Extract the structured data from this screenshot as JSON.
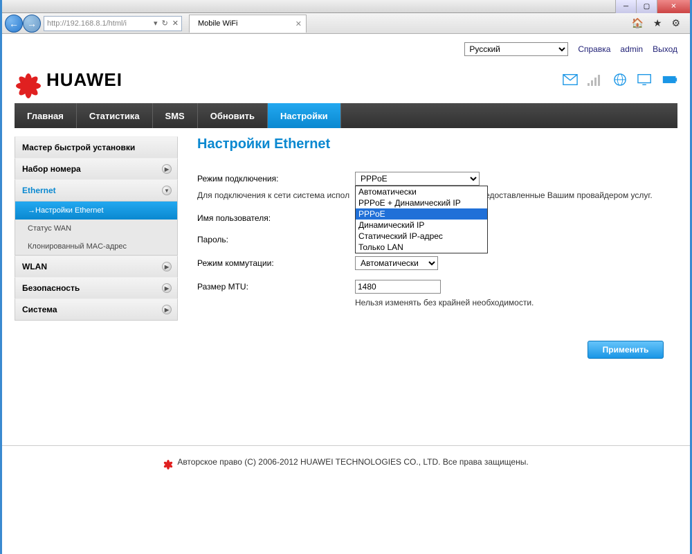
{
  "browser": {
    "url": "http://192.168.8.1/html/i",
    "tab_title": "Mobile WiFi"
  },
  "header": {
    "language": "Русский",
    "help_label": "Справка",
    "user_label": "admin",
    "logout_label": "Выход",
    "brand": "HUAWEI"
  },
  "nav": {
    "items": [
      "Главная",
      "Статистика",
      "SMS",
      "Обновить",
      "Настройки"
    ],
    "active_index": 4
  },
  "sidebar": {
    "items": [
      {
        "label": "Мастер быстрой установки",
        "type": "item"
      },
      {
        "label": "Набор номера",
        "type": "item",
        "chevron": "▶"
      },
      {
        "label": "Ethernet",
        "type": "item",
        "chevron": "▼",
        "expanded": true
      },
      {
        "label": "→Настройки Ethernet",
        "type": "sub",
        "active": true
      },
      {
        "label": "Статус WAN",
        "type": "sub"
      },
      {
        "label": "Клонированный MAC-адрес",
        "type": "sub"
      },
      {
        "label": "WLAN",
        "type": "item",
        "chevron": "▶"
      },
      {
        "label": "Безопасность",
        "type": "item",
        "chevron": "▶"
      },
      {
        "label": "Система",
        "type": "item",
        "chevron": "▶"
      }
    ]
  },
  "content": {
    "title": "Настройки Ethernet",
    "connection_mode_label": "Режим подключения:",
    "connection_mode_value": "PPPoE",
    "connection_mode_options": [
      "Автоматически",
      "PPPoE + Динамический IP",
      "PPPoE",
      "Динамический IP",
      "Статический IP-адрес",
      "Только LAN"
    ],
    "connection_mode_highlight_index": 2,
    "hint_prefix": "Для подключения к сети система испол",
    "hint_suffix": "едоставленные Вашим провайдером услуг.",
    "username_label": "Имя пользователя:",
    "password_label": "Пароль:",
    "password_value": "●●●●●●●●",
    "switching_label": "Режим коммутации:",
    "switching_value": "Автоматически",
    "mtu_label": "Размер MTU:",
    "mtu_value": "1480",
    "mtu_note": "Нельзя изменять без крайней необходимости.",
    "apply_label": "Применить"
  },
  "footer": {
    "text": "Авторское право (C) 2006-2012 HUAWEI TECHNOLOGIES CO., LTD. Все права защищены."
  }
}
